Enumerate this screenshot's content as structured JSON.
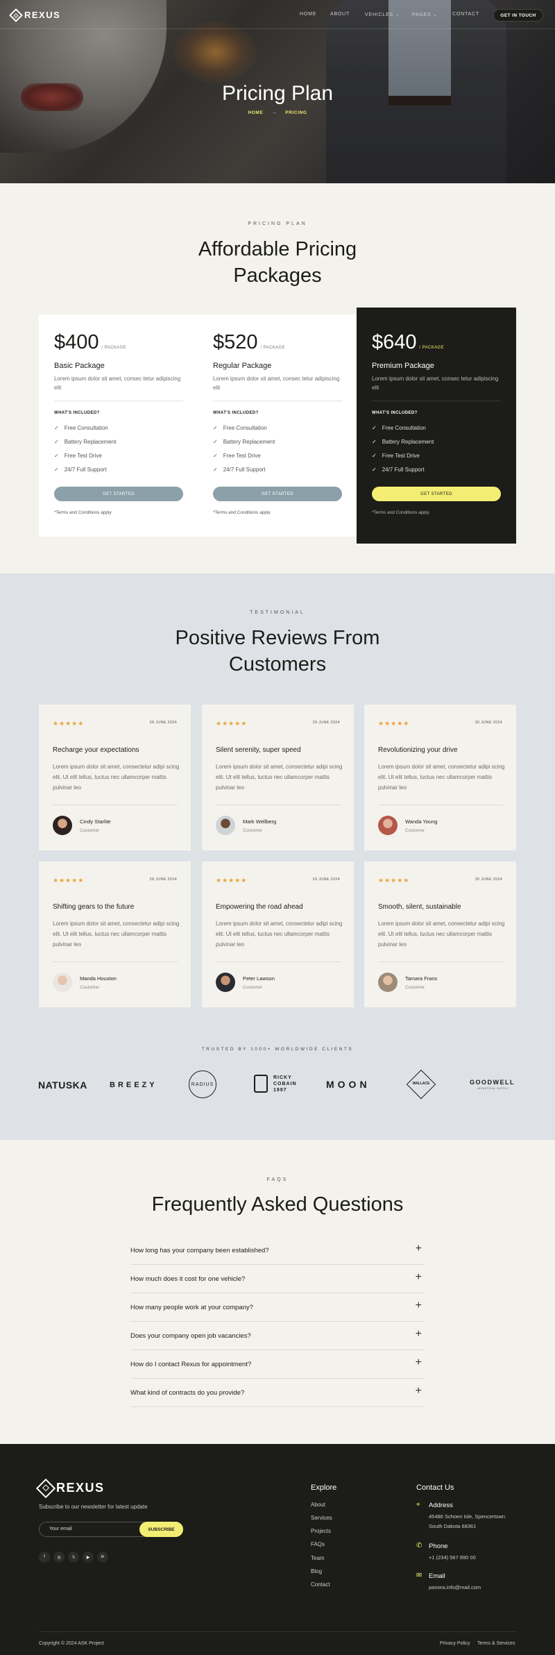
{
  "nav": {
    "brand": "REXUS",
    "links": [
      "HOME",
      "ABOUT",
      "VEHICLES ⌄",
      "PAGES ⌄",
      "CONTACT"
    ],
    "cta": "GET IN TOUCH"
  },
  "hero": {
    "title": "Pricing Plan",
    "breadcrumb_home": "HOME",
    "breadcrumb_arrow": "→",
    "breadcrumb_current": "PRICING"
  },
  "pricing": {
    "eyebrow": "PRICING PLAN",
    "title_line1": "Affordable Pricing",
    "title_line2": "Packages",
    "included_label": "WHAT'S INCLUDED?",
    "plans": [
      {
        "price": "$400",
        "per": "/ PACKAGE",
        "name": "Basic Package",
        "desc": "Lorem ipsum dolor sit amet, consec tetur adipiscing elit",
        "features": [
          "Free Consultation",
          "Battery Replacement",
          "Free Test Drive",
          "24/7 Full Support"
        ],
        "button": "GET STARTED",
        "terms": "*Terms and Conditions apply"
      },
      {
        "price": "$520",
        "per": "/ PACKAGE",
        "name": "Regular Package",
        "desc": "Lorem ipsum dolor sit amet, consec tetur adipiscing elit",
        "features": [
          "Free Consultation",
          "Battery Replacement",
          "Free Test Drive",
          "24/7 Full Support"
        ],
        "button": "GET STARTED",
        "terms": "*Terms and Conditions apply"
      },
      {
        "price": "$640",
        "per": "/ PACKAGE",
        "name": "Premium Package",
        "desc": "Lorem ipsum dolor sit amet, consec tetur adipiscing elit",
        "features": [
          "Free Consultation",
          "Battery Replacement",
          "Free Test Drive",
          "24/7 Full Support"
        ],
        "button": "GET STARTED",
        "terms": "*Terms and Conditions apply"
      }
    ]
  },
  "testimonials": {
    "eyebrow": "TESTIMONIAL",
    "title_line1": "Positive Reviews From",
    "title_line2": "Customers",
    "stars": "★★★★★",
    "body": "Lorem ipsum dolor sit amet, consectetur adipi scing elit. Ut elit tellus, luctus nec ullamcorper mattis pulvinar leo",
    "role": "Customer",
    "reviews": [
      {
        "date": "28 JUNE 2024",
        "title": "Recharge your expectations",
        "name": "Cindy Starlite"
      },
      {
        "date": "29 JUNE 2024",
        "title": "Silent serenity, super speed",
        "name": "Mark Wellberg"
      },
      {
        "date": "30 JUNE 2024",
        "title": "Revolutionizing your drive",
        "name": "Wanda Young"
      },
      {
        "date": "28 JUNE 2024",
        "title": "Shifting gears to the future",
        "name": "Manda Houston"
      },
      {
        "date": "29 JUNE 2024",
        "title": "Empowering the road ahead",
        "name": "Peter Lawson"
      },
      {
        "date": "30 JUNE 2024",
        "title": "Smooth, silent, sustainable",
        "name": "Tamara Frans"
      }
    ]
  },
  "clients": {
    "label": "TRUSTED BY 1000+ WORLDWIDE CLIENTS",
    "logos": [
      "NATUSKA",
      "BREEZY",
      "RADIUS",
      "RICKY COBAIN 1997",
      "MOON",
      "WALLACE",
      "GOODWELL",
      "INDUSTRIAL SUPPLY"
    ]
  },
  "faq": {
    "eyebrow": "FAQS",
    "title": "Frequently Asked Questions",
    "plus": "+",
    "questions": [
      "How long has your company been established?",
      "How much does it cost for one vehicle?",
      "How many people work at your company?",
      "Does your company open job vacancies?",
      "How do I contact Rexus for appointment?",
      "What kind of contracts do you provide?"
    ]
  },
  "footer": {
    "brand": "REXUS",
    "subscribe_text": "Subscribe to our newsletter for latest update",
    "email_placeholder": "Your email",
    "subscribe_button": "SUBSCRIBE",
    "socials": [
      "f",
      "◎",
      "𝕏",
      "▶",
      "in"
    ],
    "explore_title": "Explore",
    "explore_links": [
      "About",
      "Services",
      "Projects",
      "FAQs",
      "Team",
      "Blog",
      "Contact"
    ],
    "contact_title": "Contact Us",
    "address_label": "Address",
    "address_line1": "45486 Schoen Isle, Spencertown",
    "address_line2": "South Dakota 68361",
    "phone_label": "Phone",
    "phone": "+1 (234) 567 890 00",
    "email_label": "Email",
    "email": "panora.info@mail.com",
    "copyright": "Copyright © 2024 ASK Project",
    "privacy": "Privacy Policy",
    "terms": "Terms & Services"
  },
  "colors": {
    "accent": "#f3ee73",
    "dark": "#1c1c18",
    "cream": "#f4f2ec",
    "slate": "#dee2e7",
    "star": "#e8a33a"
  }
}
